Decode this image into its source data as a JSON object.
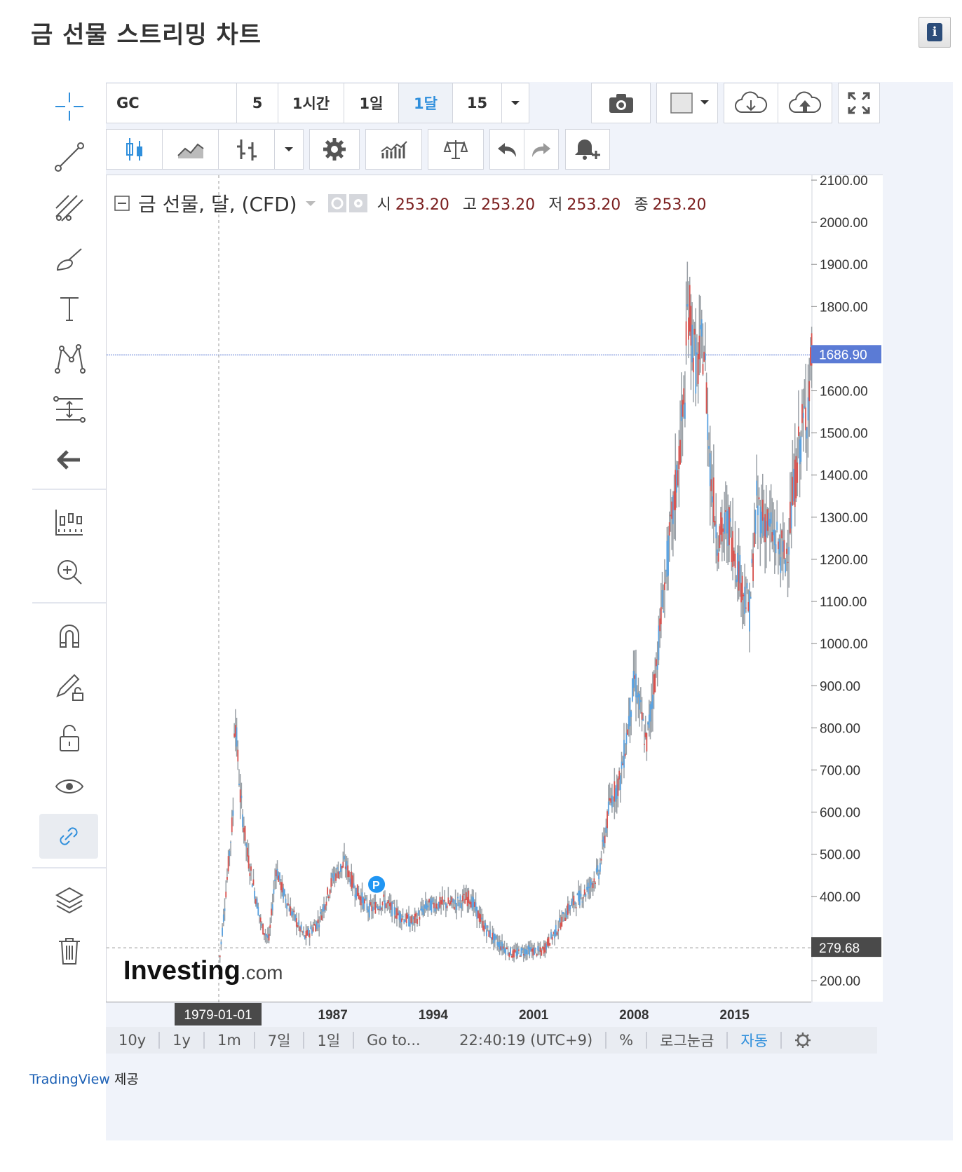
{
  "page": {
    "title": "금 선물 스트리밍 차트",
    "credit_link": "TradingView",
    "credit_suffix": "제공",
    "info_icon": "i"
  },
  "toolbar_top": {
    "symbol": "GC",
    "intervals": [
      "5",
      "1시간",
      "1일",
      "1달",
      "15"
    ],
    "selected_interval": "1달",
    "icons": [
      "chevron-down-icon",
      "camera-icon",
      "color-swatch-icon",
      "cloud-download-icon",
      "cloud-upload-icon",
      "fullscreen-icon"
    ]
  },
  "toolbar_second": {
    "icons": [
      "candlestick-icon",
      "line-chart-icon",
      "bar-style-icon",
      "chevron-down-icon",
      "settings-icon",
      "indicators-icon",
      "compare-icon",
      "undo-icon",
      "redo-icon",
      "alert-icon"
    ]
  },
  "left_toolbar": {
    "icons": [
      "crosshair-icon",
      "trend-line-icon",
      "fib-tool-icon",
      "brush-icon",
      "text-icon",
      "pattern-icon",
      "measure-icon",
      "back-arrow-icon",
      "ruler-icon",
      "zoom-in-icon",
      "magnet-icon",
      "lock-drawing-icon",
      "unlock-icon",
      "eye-icon",
      "link-icon",
      "layers-icon",
      "trash-icon"
    ]
  },
  "legend": {
    "title": "금 선물, 달, (CFD)",
    "open_label": "시",
    "open": "253.20",
    "high_label": "고",
    "high": "253.20",
    "low_label": "저",
    "low": "253.20",
    "close_label": "종",
    "close": "253.20"
  },
  "chart_data": {
    "type": "candlestick",
    "y_ticks": [
      2100,
      2000,
      1900,
      1800,
      1600,
      1500,
      1400,
      1300,
      1200,
      1100,
      1000,
      900,
      800,
      700,
      600,
      500,
      400,
      200
    ],
    "y_range": [
      150,
      2100
    ],
    "x_ticks": [
      "1987",
      "1994",
      "2001",
      "2008",
      "2015"
    ],
    "crosshair_x_label": "1979-01-01",
    "price_line": 1686.9,
    "price_line_label": "1686.90",
    "crosshair_price_label": "279.68",
    "watermark": "Investing",
    "watermark_suffix": ".com",
    "marker": "P",
    "series": [
      {
        "x": 1979.0,
        "y": 230
      },
      {
        "x": 1980.0,
        "y": 600
      },
      {
        "x": 1980.1,
        "y": 850
      },
      {
        "x": 1980.5,
        "y": 640
      },
      {
        "x": 1981.0,
        "y": 500
      },
      {
        "x": 1982.0,
        "y": 330
      },
      {
        "x": 1982.5,
        "y": 300
      },
      {
        "x": 1983.0,
        "y": 470
      },
      {
        "x": 1983.5,
        "y": 410
      },
      {
        "x": 1984.0,
        "y": 370
      },
      {
        "x": 1985.0,
        "y": 305
      },
      {
        "x": 1986.0,
        "y": 345
      },
      {
        "x": 1987.0,
        "y": 450
      },
      {
        "x": 1987.8,
        "y": 480
      },
      {
        "x": 1988.5,
        "y": 420
      },
      {
        "x": 1989.5,
        "y": 370
      },
      {
        "x": 1990.5,
        "y": 390
      },
      {
        "x": 1991.5,
        "y": 360
      },
      {
        "x": 1992.5,
        "y": 340
      },
      {
        "x": 1993.5,
        "y": 380
      },
      {
        "x": 1994.5,
        "y": 385
      },
      {
        "x": 1995.5,
        "y": 385
      },
      {
        "x": 1996.5,
        "y": 400
      },
      {
        "x": 1997.5,
        "y": 330
      },
      {
        "x": 1998.5,
        "y": 290
      },
      {
        "x": 1999.5,
        "y": 265
      },
      {
        "x": 2000.5,
        "y": 275
      },
      {
        "x": 2001.5,
        "y": 270
      },
      {
        "x": 2002.5,
        "y": 320
      },
      {
        "x": 2003.5,
        "y": 380
      },
      {
        "x": 2004.5,
        "y": 410
      },
      {
        "x": 2005.5,
        "y": 460
      },
      {
        "x": 2006.3,
        "y": 630
      },
      {
        "x": 2007.0,
        "y": 680
      },
      {
        "x": 2008.0,
        "y": 920
      },
      {
        "x": 2008.8,
        "y": 760
      },
      {
        "x": 2009.5,
        "y": 950
      },
      {
        "x": 2010.0,
        "y": 1120
      },
      {
        "x": 2010.8,
        "y": 1350
      },
      {
        "x": 2011.5,
        "y": 1600
      },
      {
        "x": 2011.7,
        "y": 1820
      },
      {
        "x": 2012.3,
        "y": 1650
      },
      {
        "x": 2012.8,
        "y": 1720
      },
      {
        "x": 2013.3,
        "y": 1400
      },
      {
        "x": 2013.8,
        "y": 1250
      },
      {
        "x": 2014.5,
        "y": 1290
      },
      {
        "x": 2015.5,
        "y": 1140
      },
      {
        "x": 2016.0,
        "y": 1080
      },
      {
        "x": 2016.5,
        "y": 1330
      },
      {
        "x": 2017.5,
        "y": 1270
      },
      {
        "x": 2018.5,
        "y": 1200
      },
      {
        "x": 2019.5,
        "y": 1480
      },
      {
        "x": 2020.0,
        "y": 1560
      },
      {
        "x": 2020.4,
        "y": 1700
      }
    ]
  },
  "bottom_bar": {
    "ranges": [
      "10y",
      "1y",
      "1m",
      "7일",
      "1일"
    ],
    "goto": "Go to...",
    "time": "22:40:19",
    "timezone": "(UTC+9)",
    "percent": "%",
    "log": "로그눈금",
    "auto": "자동",
    "settings_icon": "gear-icon"
  },
  "colors": {
    "up": "#d9534f",
    "down": "#5aa2e0",
    "wick": "#9aa0a6",
    "price_line": "#5b7bd5",
    "selected": "#2f8fdc"
  }
}
